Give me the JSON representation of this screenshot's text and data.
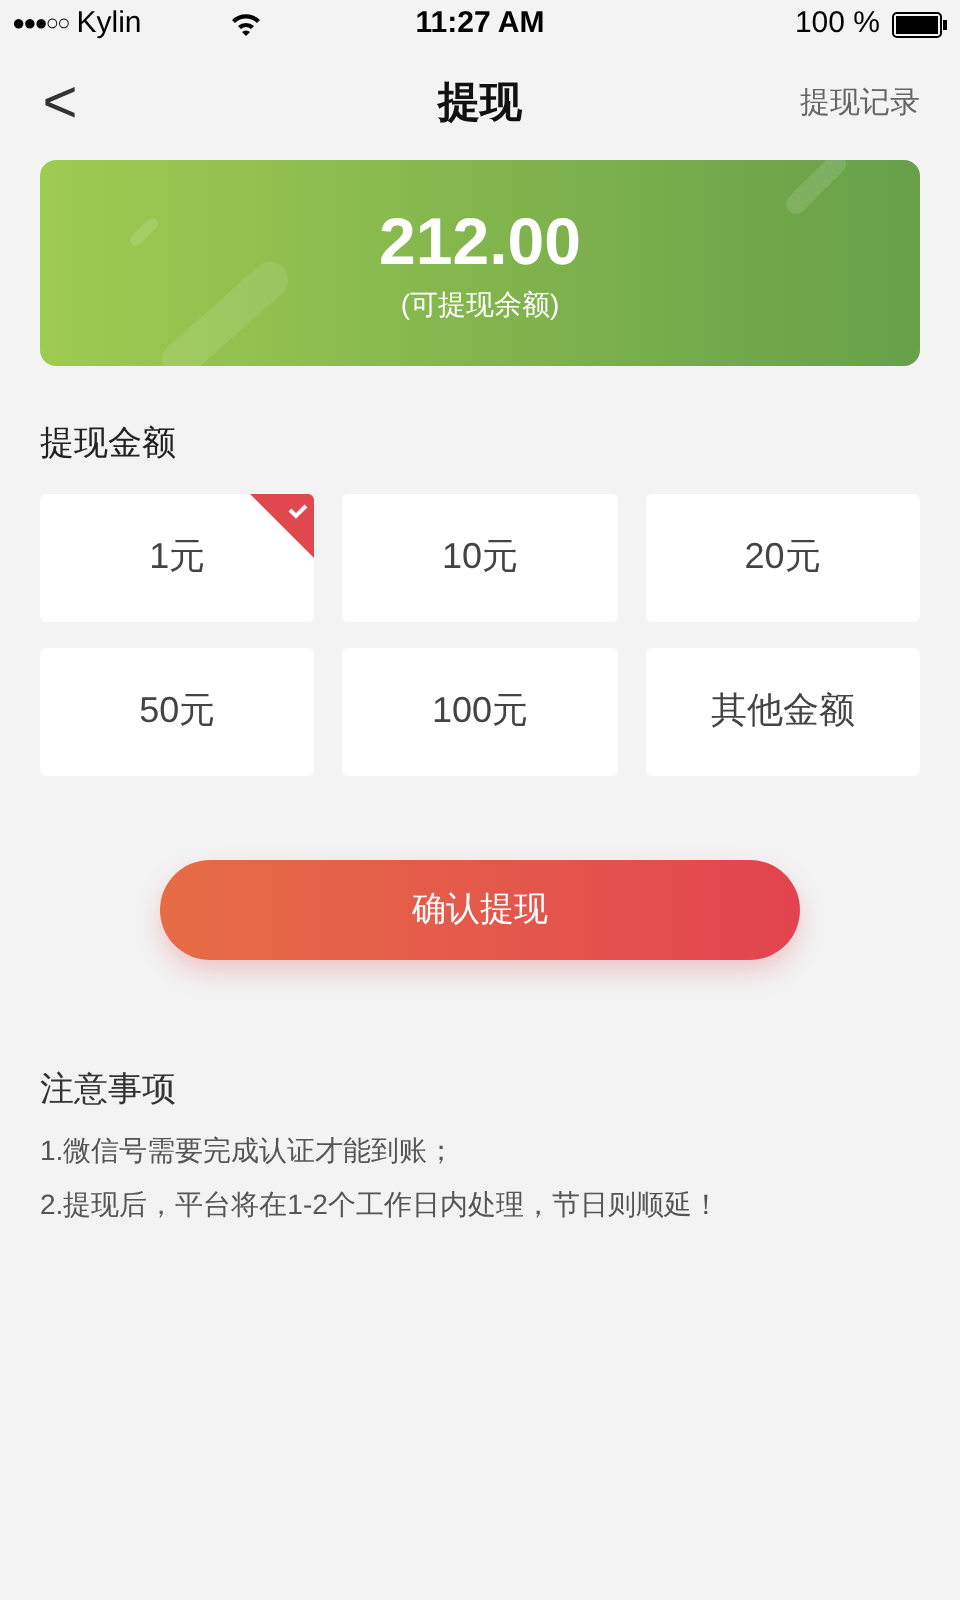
{
  "status_bar": {
    "carrier": "Kylin",
    "signal_dots": "●●●○○",
    "time": "11:27 AM",
    "battery": "100 %"
  },
  "nav": {
    "title": "提现",
    "back": "<",
    "action": "提现记录"
  },
  "balance": {
    "amount": "212.00",
    "caption": "(可提现余额)"
  },
  "amount_section": {
    "label": "提现金额",
    "options": [
      {
        "label": "1元",
        "selected": true
      },
      {
        "label": "10元",
        "selected": false
      },
      {
        "label": "20元",
        "selected": false
      },
      {
        "label": "50元",
        "selected": false
      },
      {
        "label": "100元",
        "selected": false
      },
      {
        "label": "其他金额",
        "selected": false
      }
    ]
  },
  "confirm_button": "确认提现",
  "notes": {
    "title": "注意事项",
    "items": [
      "1.微信号需要完成认证才能到账；",
      "2.提现后，平台将在1-2个工作日内处理，节日则顺延！"
    ]
  }
}
